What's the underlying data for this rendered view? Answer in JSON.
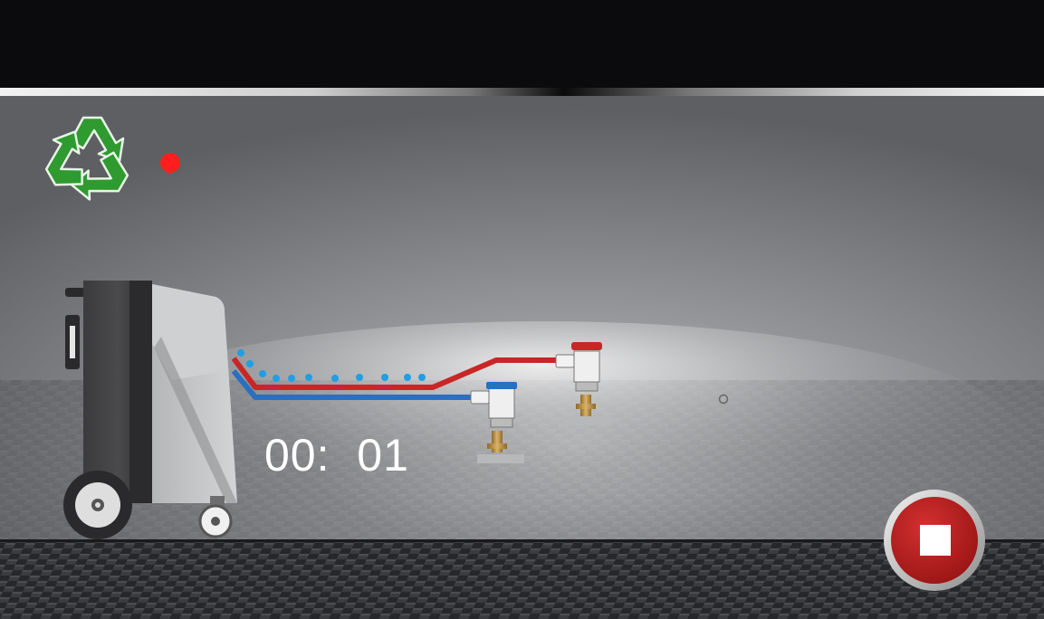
{
  "status": {
    "process_icon": "recycle-icon",
    "indicator_color": "#ff1e1e"
  },
  "timer": {
    "display": "00:  01"
  },
  "controls": {
    "stop_icon": "stop-icon",
    "stop_color": "#b81c1c"
  },
  "hoses": {
    "high_pressure_color": "#c92626",
    "low_pressure_color": "#2a6fc0",
    "flow_color": "#1e9fe6"
  }
}
